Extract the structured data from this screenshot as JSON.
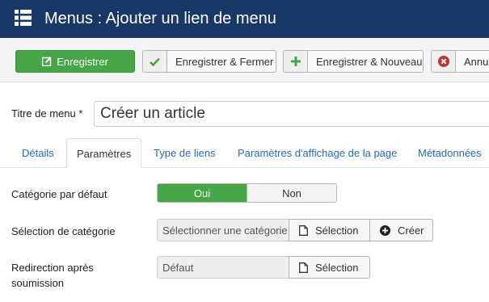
{
  "header": {
    "title": "Menus : Ajouter un lien de menu",
    "icon": "list-icon"
  },
  "toolbar": {
    "save_label": "Enregistrer",
    "save_close_label": "Enregistrer & Fermer",
    "save_new_label": "Enregistrer & Nouveau",
    "cancel_label": "Annuler"
  },
  "form": {
    "title_label": "Titre de menu *",
    "title_value": "Créer un article"
  },
  "tabs": [
    {
      "label": "Détails"
    },
    {
      "label": "Paramètres"
    },
    {
      "label": "Type de liens"
    },
    {
      "label": "Paramètres d'affichage de la page"
    },
    {
      "label": "Métadonnées"
    }
  ],
  "params": {
    "default_category_label": "Catégorie par défaut",
    "toggle_yes": "Oui",
    "toggle_no": "Non",
    "category_selection_label": "Sélection de catégorie",
    "category_placeholder": "Sélectionner une catégorie",
    "select_label": "Sélection",
    "create_label": "Créer",
    "redirect_label_line1": "Redirection après",
    "redirect_label_line2": "soumission",
    "redirect_value": "Défaut",
    "redirect_select_label": "Sélection"
  },
  "colors": {
    "header_bg": "#1a3867",
    "save_green": "#46a546",
    "link_blue": "#2a69b8",
    "cancel_red": "#bd362f"
  }
}
